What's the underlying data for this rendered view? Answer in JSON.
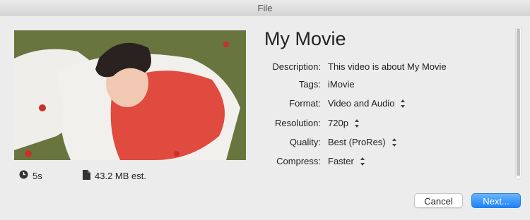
{
  "window": {
    "title": "File"
  },
  "preview": {
    "duration": "5s",
    "size": "43.2 MB est.",
    "icons": {
      "duration": "clock-icon",
      "size": "document-icon"
    }
  },
  "movie": {
    "title": "My Movie"
  },
  "fields": {
    "description": {
      "label": "Description:",
      "value": "This video is about My Movie"
    },
    "tags": {
      "label": "Tags:",
      "value": "iMovie"
    },
    "format": {
      "label": "Format:",
      "value": "Video and Audio"
    },
    "resolution": {
      "label": "Resolution:",
      "value": "720p"
    },
    "quality": {
      "label": "Quality:",
      "value": "Best (ProRes)"
    },
    "compress": {
      "label": "Compress:",
      "value": "Faster"
    }
  },
  "buttons": {
    "cancel": "Cancel",
    "next": "Next..."
  },
  "colors": {
    "accent": "#1a82fb",
    "window_bg": "#ececec"
  }
}
